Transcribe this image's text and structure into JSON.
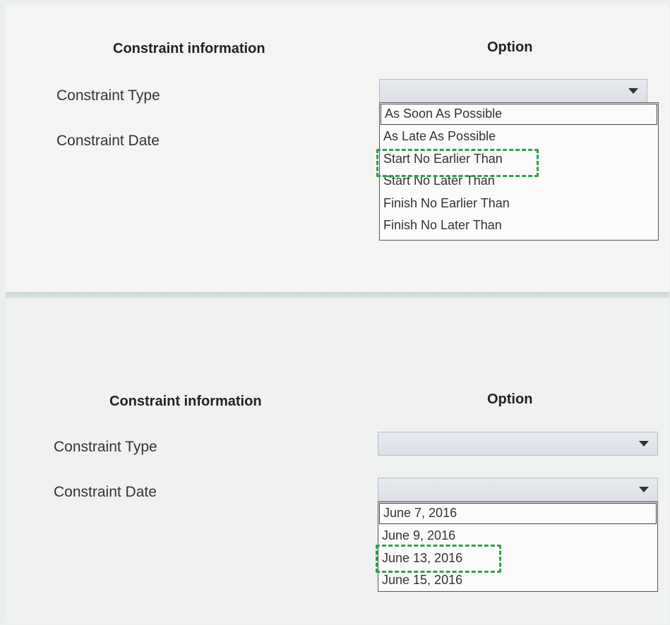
{
  "sections": [
    {
      "header_info": "Constraint information",
      "header_option": "Option",
      "rows": [
        {
          "label": "Constraint Type"
        },
        {
          "label": "Constraint Date"
        }
      ],
      "dropdown_options": [
        "As Soon As Possible",
        "As Late As Possible",
        "Start No Earlier Than",
        "Start No Later Than",
        "Finish No Earlier Than",
        "Finish No Later Than"
      ],
      "selected_option": "Start No Earlier Than"
    },
    {
      "header_info": "Constraint information",
      "header_option": "Option",
      "rows": [
        {
          "label": "Constraint Type"
        },
        {
          "label": "Constraint Date"
        }
      ],
      "dropdown_options": [
        "June 7, 2016",
        "June 9, 2016",
        "June 13, 2016",
        "June 15, 2016"
      ],
      "selected_option": "June 13, 2016"
    }
  ],
  "highlight_color": "#2fa14a",
  "icons": {
    "dropdown_arrow": "triangle-down-icon"
  }
}
